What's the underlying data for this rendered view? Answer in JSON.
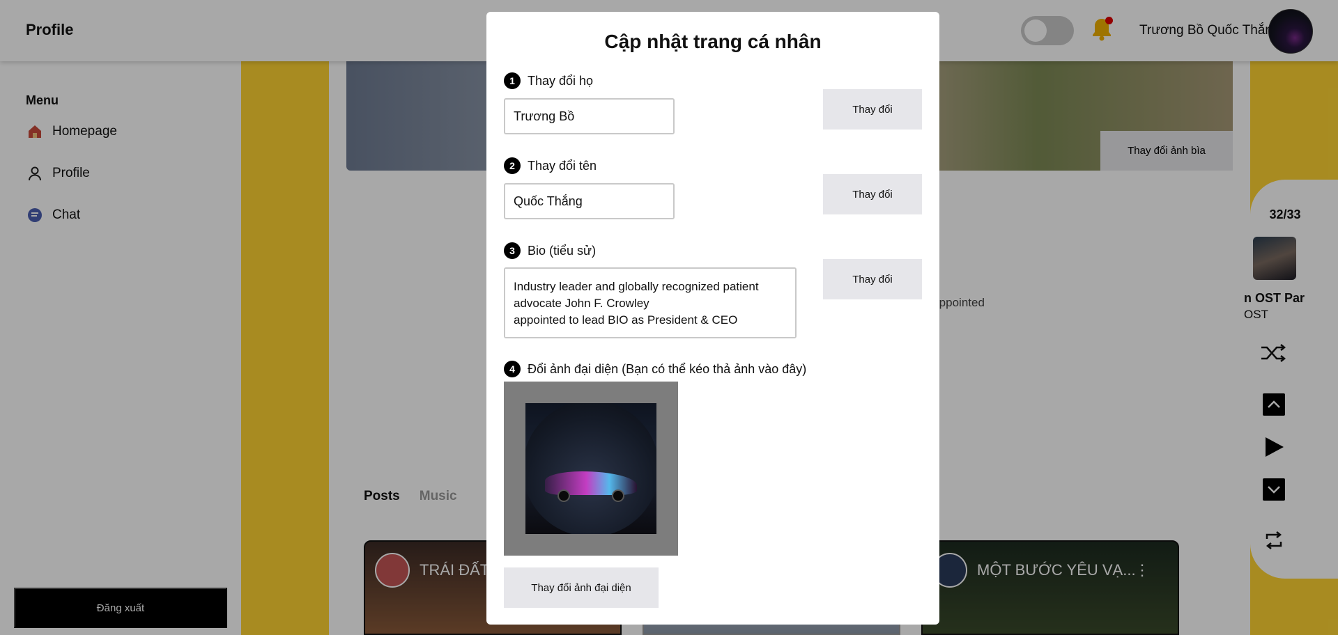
{
  "header": {
    "title": "Profile",
    "user_name": "Trương Bồ Quốc Thắng"
  },
  "sidebar": {
    "menu_title": "Menu",
    "items": [
      {
        "label": "Homepage",
        "icon": "home-icon"
      },
      {
        "label": "Profile",
        "icon": "user-icon"
      },
      {
        "label": "Chat",
        "icon": "chat-icon"
      }
    ],
    "logout_label": "Đăng xuất"
  },
  "profile": {
    "cover_button": "Thay đổi ảnh bìa",
    "bio_peek": "y appointed",
    "tabs": [
      {
        "label": "Posts",
        "active": true
      },
      {
        "label": "Music",
        "active": false
      }
    ],
    "posts": [
      {
        "title": "TRÁI ĐẤT"
      },
      {
        "title": "MỘT BƯỚC YÊU VẠ..."
      }
    ]
  },
  "player": {
    "count": "32/33",
    "track": "n OST Par",
    "artist": "OST"
  },
  "modal": {
    "title": "Cập nhật trang cá nhân",
    "steps": [
      {
        "number": "1",
        "label": "Thay đổi họ",
        "value": "Trương Bồ",
        "button": "Thay đổi"
      },
      {
        "number": "2",
        "label": "Thay đổi tên",
        "value": "Quốc Thắng",
        "button": "Thay đổi"
      },
      {
        "number": "3",
        "label": "Bio (tiểu sử)",
        "value": "Industry leader and globally recognized patient advocate John F. Crowley\nappointed to lead BIO as President & CEO",
        "button": "Thay đổi"
      },
      {
        "number": "4",
        "label": "Đổi ảnh đại diện (Bạn có thể kéo thả ảnh vào đây)",
        "button": "Thay đổi ảnh đại diện"
      }
    ]
  },
  "colors": {
    "accent_yellow": "#ffd433",
    "button_gray": "#e6e6ea",
    "notification_dot": "#e00000"
  }
}
